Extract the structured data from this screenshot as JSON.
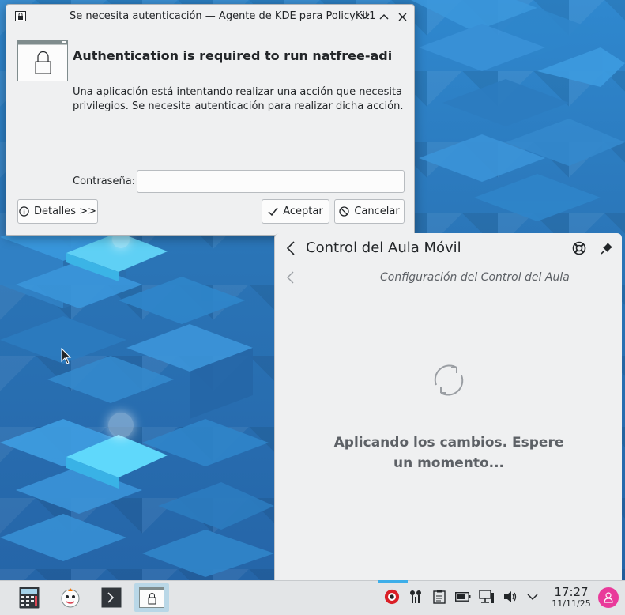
{
  "dialog": {
    "window_title": "Se necesita autenticación — Agente de KDE para PolicyKit1",
    "heading": "Authentication is required to run natfree-adi",
    "message": "Una aplicación está intentando realizar una acción que necesita privilegios. Se necesita autenticación para realizar dicha acción.",
    "password_label": "Contraseña:",
    "password_value": "",
    "details_label": "Detalles >>",
    "accept_label": "Aceptar",
    "cancel_label": "Cancelar"
  },
  "aula": {
    "title": "Control del Aula Móvil",
    "subtitle": "Configuración del Control del Aula",
    "status": "Aplicando los cambios. Espere un momento..."
  },
  "taskbar": {
    "clock_time": "17:27",
    "clock_date": "11/11/25"
  },
  "colors": {
    "accent": "#3daee9",
    "record_red": "#da1f27",
    "user_avatar": "#e93a9a"
  }
}
